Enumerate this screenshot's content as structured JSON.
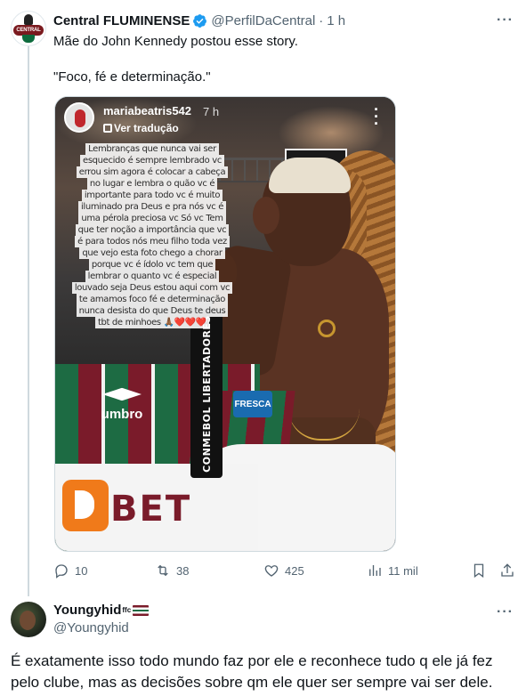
{
  "main_tweet": {
    "display_name": "Central FLUMINENSE",
    "avatar_text": "CENTRAL FLUMINENSE",
    "handle": "@PerfilDaCentral",
    "separator": "·",
    "time": "1 h",
    "more_icon": "more-horizontal-icon",
    "text_line1": "Mãe do John Kennedy postou esse story.",
    "text_line2": "\"Foco, fé e determinação.\""
  },
  "story": {
    "username": "mariabeatris542",
    "time": "7 h",
    "translate_label": "Ver tradução",
    "text_lines": [
      "Lembranças que nunca vai ser",
      "esquecido é sempre lembrado vc",
      "errou sim agora é colocar a cabeça",
      "no lugar e lembra o quão vc é",
      "importante para todo vc é muito",
      "iluminado pra Deus e pra nós vc é",
      "uma pérola preciosa vc   Só vc   Tem",
      "que ter noção a importância que  vc",
      "é para todos nós meu filho toda vez",
      "que vejo esta foto chego a chorar",
      "porque vc é ídolo vc tem que",
      "lembrar o quanto vc é especial",
      "louvado seja Deus estou aqui com vc",
      "te amamos foco fé e determinação",
      "nunca desista do que Deus te deus",
      "tbt de minhoes 🙏🏾❤️❤️❤️"
    ],
    "patch_text": "CONMEBOL LIBERTADORES",
    "sponsor_patch": "FRESCA",
    "kit_brand": "umbro",
    "shirt_sponsor": "BET"
  },
  "actions": {
    "replies": "10",
    "retweets": "38",
    "likes": "425",
    "views": "11 mil"
  },
  "reply": {
    "display_name": "Youngyhid",
    "superscript": "ffc",
    "handle": "@Youngyhid",
    "text_line1": "É exatamente isso todo mundo faz por ele e reconhece tudo q ele já fez",
    "text_line2": "pelo clube, mas as decisões sobre qm ele quer ser sempre vai ser dele."
  },
  "colors": {
    "text_primary": "#0f1419",
    "text_secondary": "#536471",
    "verified_blue": "#1d9bf0",
    "fluminense_grena": "#7a1b2a",
    "fluminense_green": "#1d6b43"
  }
}
